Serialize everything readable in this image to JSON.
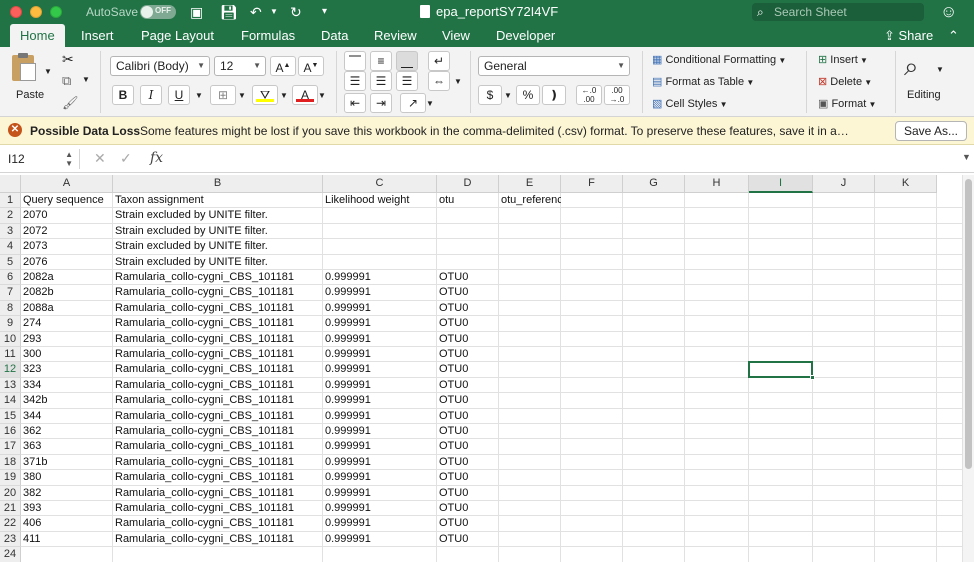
{
  "titlebar": {
    "autosave_label": "AutoSave",
    "autosave_state": "OFF",
    "doc_title": "epa_reportSY72I4VF",
    "search_placeholder": "Search Sheet"
  },
  "tabs": [
    "Home",
    "Insert",
    "Page Layout",
    "Formulas",
    "Data",
    "Review",
    "View",
    "Developer"
  ],
  "active_tab": "Home",
  "share_label": "Share",
  "ribbon": {
    "paste_label": "Paste",
    "font_name": "Calibri (Body)",
    "font_size": "12",
    "number_format": "General",
    "conditional_formatting": "Conditional Formatting",
    "format_as_table": "Format as Table",
    "cell_styles": "Cell Styles",
    "insert": "Insert",
    "delete": "Delete",
    "format": "Format",
    "editing": "Editing"
  },
  "message_bar": {
    "title": "Possible Data Loss",
    "text": "Some features might be lost if you save this workbook in the comma-delimited (.csv) format. To preserve these features, save it in a…",
    "button": "Save As..."
  },
  "formula_bar": {
    "name_box": "I12",
    "formula": ""
  },
  "grid": {
    "columns": [
      "A",
      "B",
      "C",
      "D",
      "E",
      "F",
      "G",
      "H",
      "I",
      "J",
      "K"
    ],
    "selected_column": "I",
    "selected_row": 12,
    "row_numbers": [
      1,
      2,
      3,
      4,
      5,
      6,
      7,
      8,
      9,
      10,
      11,
      12,
      13,
      14,
      15,
      16,
      17,
      18,
      19,
      20,
      21,
      22,
      23,
      24
    ],
    "rows": [
      [
        "Query sequence",
        "Taxon assignment",
        "Likelihood weight",
        "otu",
        "otu_references"
      ],
      [
        "2070",
        "Strain excluded by UNITE filter.",
        "",
        "",
        ""
      ],
      [
        "2072",
        "Strain excluded by UNITE filter.",
        "",
        "",
        ""
      ],
      [
        "2073",
        "Strain excluded by UNITE filter.",
        "",
        "",
        ""
      ],
      [
        "2076",
        "Strain excluded by UNITE filter.",
        "",
        "",
        ""
      ],
      [
        "2082a",
        "Ramularia_collo-cygni_CBS_101181",
        "0.999991",
        "OTU0",
        ""
      ],
      [
        "2082b",
        "Ramularia_collo-cygni_CBS_101181",
        "0.999991",
        "OTU0",
        ""
      ],
      [
        "2088a",
        "Ramularia_collo-cygni_CBS_101181",
        "0.999991",
        "OTU0",
        ""
      ],
      [
        "274",
        "Ramularia_collo-cygni_CBS_101181",
        "0.999991",
        "OTU0",
        ""
      ],
      [
        "293",
        "Ramularia_collo-cygni_CBS_101181",
        "0.999991",
        "OTU0",
        ""
      ],
      [
        "300",
        "Ramularia_collo-cygni_CBS_101181",
        "0.999991",
        "OTU0",
        ""
      ],
      [
        "323",
        "Ramularia_collo-cygni_CBS_101181",
        "0.999991",
        "OTU0",
        ""
      ],
      [
        "334",
        "Ramularia_collo-cygni_CBS_101181",
        "0.999991",
        "OTU0",
        ""
      ],
      [
        "342b",
        "Ramularia_collo-cygni_CBS_101181",
        "0.999991",
        "OTU0",
        ""
      ],
      [
        "344",
        "Ramularia_collo-cygni_CBS_101181",
        "0.999991",
        "OTU0",
        ""
      ],
      [
        "362",
        "Ramularia_collo-cygni_CBS_101181",
        "0.999991",
        "OTU0",
        ""
      ],
      [
        "363",
        "Ramularia_collo-cygni_CBS_101181",
        "0.999991",
        "OTU0",
        ""
      ],
      [
        "371b",
        "Ramularia_collo-cygni_CBS_101181",
        "0.999991",
        "OTU0",
        ""
      ],
      [
        "380",
        "Ramularia_collo-cygni_CBS_101181",
        "0.999991",
        "OTU0",
        ""
      ],
      [
        "382",
        "Ramularia_collo-cygni_CBS_101181",
        "0.999991",
        "OTU0",
        ""
      ],
      [
        "393",
        "Ramularia_collo-cygni_CBS_101181",
        "0.999991",
        "OTU0",
        ""
      ],
      [
        "406",
        "Ramularia_collo-cygni_CBS_101181",
        "0.999991",
        "OTU0",
        ""
      ],
      [
        "411",
        "Ramularia_collo-cygni_CBS_101181",
        "0.999991",
        "OTU0",
        ""
      ],
      [
        "",
        "",
        "",
        "",
        ""
      ]
    ]
  },
  "colors": {
    "brand": "#217346",
    "message_bg": "#fcf6d5"
  }
}
